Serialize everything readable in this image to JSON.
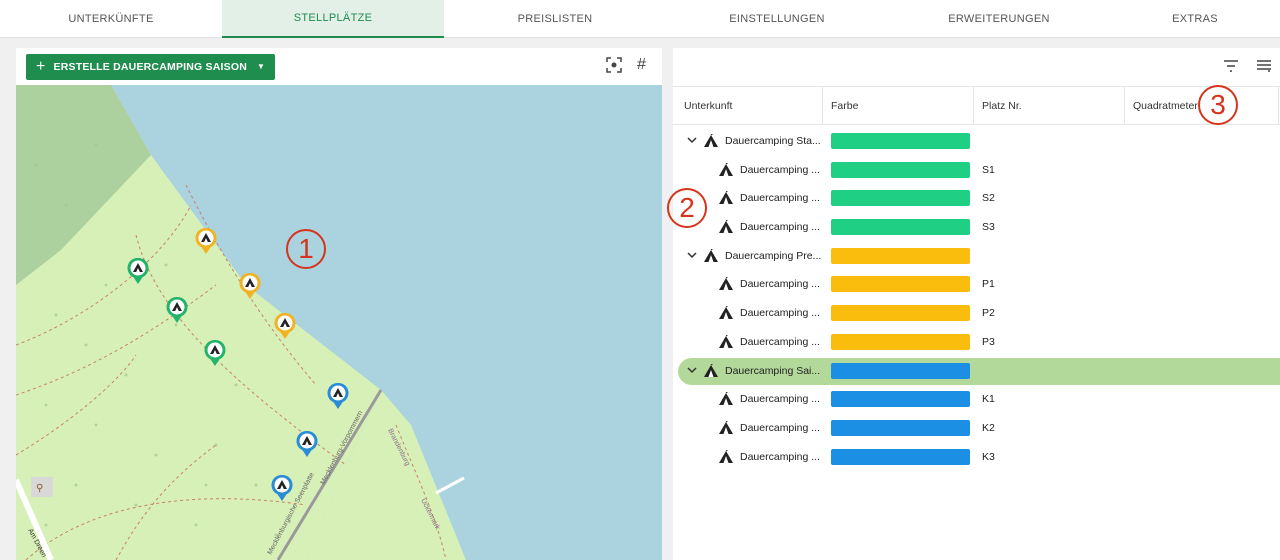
{
  "tabs": [
    {
      "label": "UNTERKÜNFTE",
      "active": false
    },
    {
      "label": "STELLPLÄTZE",
      "active": true
    },
    {
      "label": "PREISLISTEN",
      "active": false
    },
    {
      "label": "EINSTELLUNGEN",
      "active": false
    },
    {
      "label": "ERWEITERUNGEN",
      "active": false
    },
    {
      "label": "EXTRAS",
      "active": false
    }
  ],
  "left_toolbar": {
    "create_label": "ERSTELLE DAUERCAMPING SAISON",
    "icons": [
      "focus-icon",
      "hash-icon"
    ]
  },
  "map": {
    "labels": {
      "road1": "Mecklenburg-Vorpommern",
      "road2": "Brandenburg",
      "road3": "Uckermark",
      "road4": "Am Dreen",
      "road5": "Mecklenburgische Seenplatte"
    },
    "pins": [
      {
        "color": "#f0b323"
      },
      {
        "color": "#f0b323"
      },
      {
        "color": "#f0b323"
      },
      {
        "color": "#24b36b"
      },
      {
        "color": "#24b36b"
      },
      {
        "color": "#24b36b"
      },
      {
        "color": "#2a8bd6"
      },
      {
        "color": "#2a8bd6"
      },
      {
        "color": "#2a8bd6"
      }
    ]
  },
  "table": {
    "headers": {
      "unterkunft": "Unterkunft",
      "farbe": "Farbe",
      "platz": "Platz Nr.",
      "qm": "Quadratmeter"
    },
    "rows": [
      {
        "name": "Dauercamping Sta...",
        "level": 0,
        "color": "#1fcf84",
        "platz": ""
      },
      {
        "name": "Dauercamping ...",
        "level": 1,
        "color": "#1fcf84",
        "platz": "S1"
      },
      {
        "name": "Dauercamping ...",
        "level": 1,
        "color": "#1fcf84",
        "platz": "S2"
      },
      {
        "name": "Dauercamping ...",
        "level": 1,
        "color": "#1fcf84",
        "platz": "S3"
      },
      {
        "name": "Dauercamping Pre...",
        "level": 0,
        "color": "#fbbd0d",
        "platz": ""
      },
      {
        "name": "Dauercamping ...",
        "level": 1,
        "color": "#fbbd0d",
        "platz": "P1"
      },
      {
        "name": "Dauercamping ...",
        "level": 1,
        "color": "#fbbd0d",
        "platz": "P2"
      },
      {
        "name": "Dauercamping ...",
        "level": 1,
        "color": "#fbbd0d",
        "platz": "P3"
      },
      {
        "name": "Dauercamping Sai...",
        "level": 0,
        "color": "#1a8fe3",
        "platz": "",
        "selected": true
      },
      {
        "name": "Dauercamping ...",
        "level": 1,
        "color": "#1a8fe3",
        "platz": "K1"
      },
      {
        "name": "Dauercamping ...",
        "level": 1,
        "color": "#1a8fe3",
        "platz": "K2"
      },
      {
        "name": "Dauercamping ...",
        "level": 1,
        "color": "#1a8fe3",
        "platz": "K3"
      }
    ]
  },
  "annotations": {
    "a1": "1",
    "a2": "2",
    "a3": "3"
  },
  "colors": {
    "accent": "#1e8d4e",
    "annotation": "#d4351c",
    "selected_row": "#b3d99a"
  }
}
